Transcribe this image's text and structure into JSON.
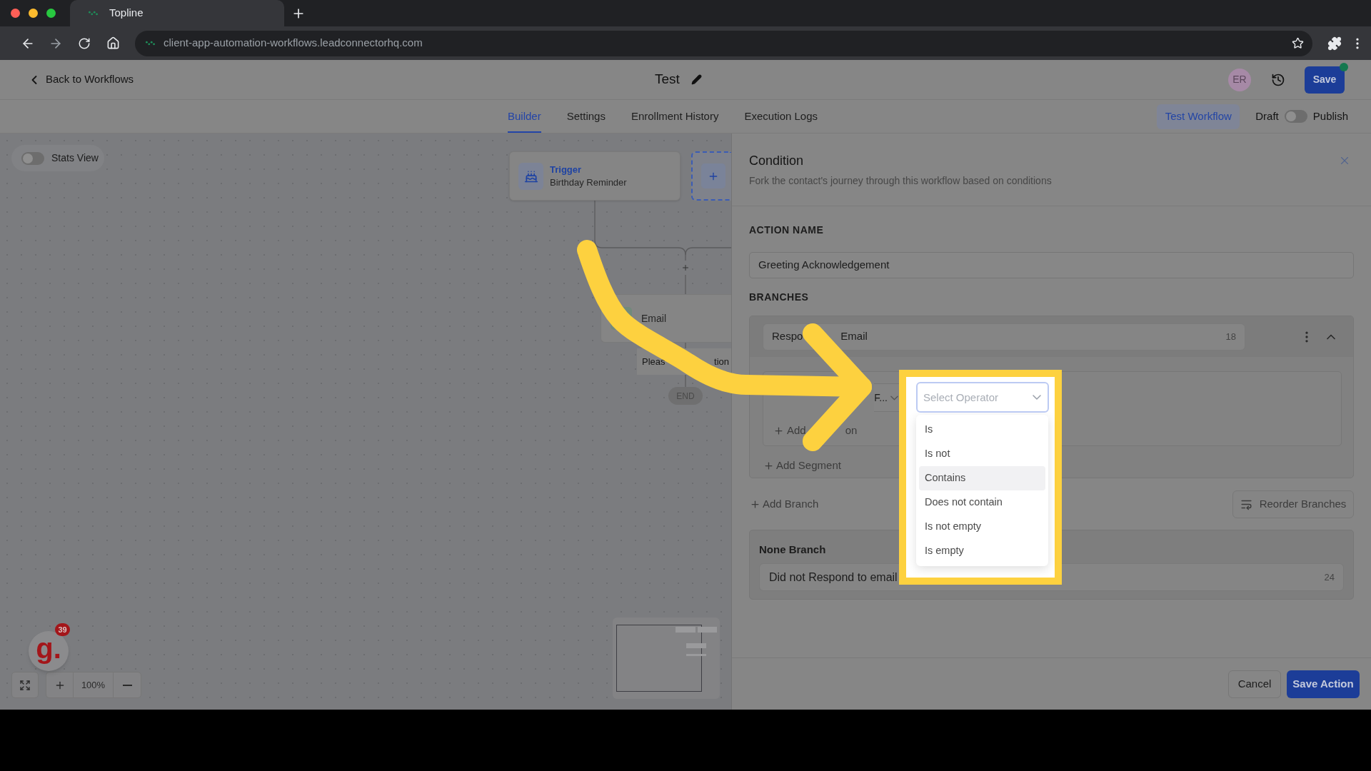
{
  "browser": {
    "tab_title": "Topline",
    "url": "client-app-automation-workflows.leadconnectorhq.com"
  },
  "header": {
    "back_link": "Back to Workflows",
    "title": "Test",
    "avatar": "ER",
    "save_button": "Save"
  },
  "tabs": [
    {
      "label": "Builder",
      "selected": true
    },
    {
      "label": "Settings",
      "selected": false
    },
    {
      "label": "Enrollment History",
      "selected": false
    },
    {
      "label": "Execution Logs",
      "selected": false
    }
  ],
  "test_button": "Test Workflow",
  "publish_toggle": {
    "off_label": "Draft",
    "on_label": "Publish",
    "on": false
  },
  "canvas": {
    "stats_toggle": {
      "label": "Stats View",
      "on": false
    },
    "trigger": {
      "title": "Trigger",
      "subtitle": "Birthday Reminder"
    },
    "email_node": {
      "label": "Email"
    },
    "note_fragments": [
      "Pleas",
      "tion"
    ],
    "end_label": "END",
    "zoom_level": "100%",
    "logo_text": "g.",
    "logo_badge": "39"
  },
  "panel": {
    "title": "Condition",
    "subtitle": "Fork the contact's journey through this workflow based on conditions",
    "action_name_label": "ACTION NAME",
    "action_name": "Greeting Acknowledgement",
    "branches_label": "BRANCHES",
    "branch": {
      "name_fragments": [
        "Respo",
        "Email"
      ],
      "count": "18",
      "field_fragment": "F...",
      "operator_placeholder": "Select Operator",
      "operator_options": [
        {
          "label": "Is",
          "highlighted": false
        },
        {
          "label": "Is not",
          "highlighted": false
        },
        {
          "label": "Contains",
          "highlighted": true
        },
        {
          "label": "Does not contain",
          "highlighted": false
        },
        {
          "label": "Is not empty",
          "highlighted": false
        },
        {
          "label": "Is empty",
          "highlighted": false
        }
      ],
      "add_condition_fragments": [
        "Add",
        "on"
      ],
      "add_segment": "Add Segment"
    },
    "add_branch": "Add Branch",
    "reorder_button": "Reorder Branches",
    "none_branch": {
      "label": "None Branch",
      "name": "Did not Respond to email",
      "count": "24"
    },
    "cancel_button": "Cancel",
    "save_button": "Save Action"
  }
}
